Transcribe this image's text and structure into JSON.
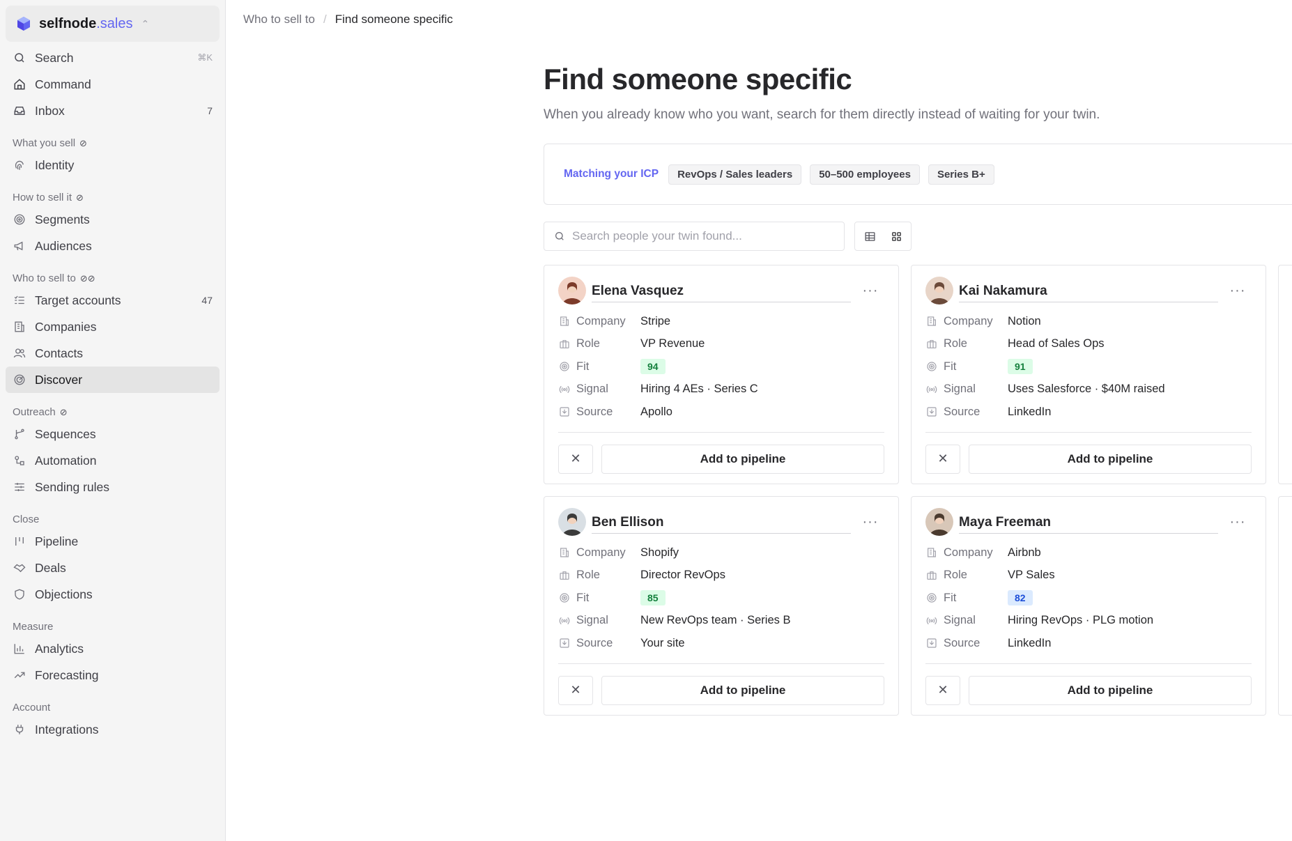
{
  "brand": {
    "name_bold": "selfnode",
    "name_accent": ".sales",
    "accent_color": "#6366f1"
  },
  "sidebar": {
    "top": [
      {
        "label": "Search",
        "kbd": "⌘K",
        "icon": "search-icon"
      },
      {
        "label": "Command",
        "icon": "home-icon"
      },
      {
        "label": "Inbox",
        "count": "7",
        "icon": "inbox-icon"
      }
    ],
    "sections": [
      {
        "label": "What you sell",
        "items": [
          {
            "label": "Identity",
            "icon": "fingerprint-icon"
          }
        ]
      },
      {
        "label": "How to sell it",
        "items": [
          {
            "label": "Segments",
            "icon": "target-icon"
          },
          {
            "label": "Audiences",
            "icon": "megaphone-icon"
          }
        ]
      },
      {
        "label": "Who to sell to",
        "items": [
          {
            "label": "Target accounts",
            "count": "47",
            "icon": "list-check-icon"
          },
          {
            "label": "Companies",
            "icon": "building-icon"
          },
          {
            "label": "Contacts",
            "icon": "users-icon"
          },
          {
            "label": "Discover",
            "icon": "radar-icon",
            "active": true
          }
        ]
      },
      {
        "label": "Outreach",
        "items": [
          {
            "label": "Sequences",
            "icon": "git-branch-icon"
          },
          {
            "label": "Automation",
            "icon": "workflow-icon"
          },
          {
            "label": "Sending rules",
            "icon": "sliders-icon"
          }
        ]
      },
      {
        "label": "Close",
        "items": [
          {
            "label": "Pipeline",
            "icon": "kanban-icon"
          },
          {
            "label": "Deals",
            "icon": "handshake-icon"
          },
          {
            "label": "Objections",
            "icon": "shield-icon"
          }
        ]
      },
      {
        "label": "Measure",
        "items": [
          {
            "label": "Analytics",
            "icon": "bar-chart-icon"
          },
          {
            "label": "Forecasting",
            "icon": "trending-up-icon"
          }
        ]
      },
      {
        "label": "Account",
        "items": [
          {
            "label": "Integrations",
            "icon": "plug-icon"
          }
        ]
      }
    ]
  },
  "breadcrumb": {
    "parent": "Who to sell to",
    "separator": "/",
    "current": "Find someone specific"
  },
  "page": {
    "title": "Find someone specific",
    "subtitle": "When you already know who you want, search for them directly instead of waiting for your twin."
  },
  "icp": {
    "label": "Matching your ICP",
    "chips": [
      "RevOps / Sales leaders",
      "50–500 employees",
      "Series B+"
    ]
  },
  "search": {
    "placeholder": "Search people your twin found...",
    "value": ""
  },
  "field_labels": {
    "company": "Company",
    "role": "Role",
    "fit": "Fit",
    "signal": "Signal",
    "source": "Source"
  },
  "cards": [
    {
      "name": "Elena Vasquez",
      "company": "Stripe",
      "role": "VP Revenue",
      "fit": "94",
      "signal": "Hiring 4 AEs · Series C",
      "source": "Apollo",
      "fit_color": "green"
    },
    {
      "name": "Kai Nakamura",
      "company": "Notion",
      "role": "Head of Sales Ops",
      "fit": "91",
      "signal": "Uses Salesforce · $40M raised",
      "source": "LinkedIn",
      "fit_color": "green"
    },
    {
      "name": "Ben Ellison",
      "company": "Shopify",
      "role": "Director RevOps",
      "fit": "85",
      "signal": "New RevOps team · Series B",
      "source": "Your site",
      "fit_color": "green"
    },
    {
      "name": "Maya Freeman",
      "company": "Airbnb",
      "role": "VP Sales",
      "fit": "82",
      "signal": "Hiring RevOps · PLG motion",
      "source": "LinkedIn",
      "fit_color": "blue"
    }
  ],
  "actions": {
    "add": "Add to pipeline",
    "dismiss": "✕",
    "more": "···"
  },
  "colors": {
    "fit_green_bg": "#dcfce7",
    "fit_green_fg": "#15803d",
    "fit_blue_bg": "#dbeafe",
    "fit_blue_fg": "#1d4ed8"
  }
}
